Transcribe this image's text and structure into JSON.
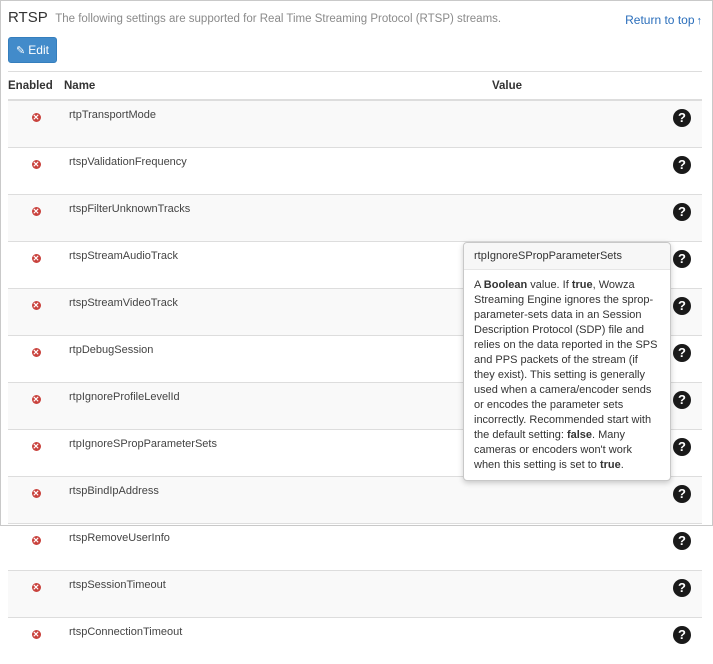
{
  "header": {
    "title": "RTSP",
    "subtitle": "The following settings are supported for Real Time Streaming Protocol (RTSP) streams.",
    "top_link": "Return to top",
    "top_link_icon": "arrow-up-icon"
  },
  "toolbar": {
    "edit_label": "Edit",
    "edit_icon": "pencil-icon",
    "edit_color": "#428bca"
  },
  "table": {
    "columns": [
      "Enabled",
      "Name",
      "Value"
    ],
    "rows": [
      {
        "enabled": false,
        "name": "rtpTransportMode",
        "value": ""
      },
      {
        "enabled": false,
        "name": "rtspValidationFrequency",
        "value": ""
      },
      {
        "enabled": false,
        "name": "rtspFilterUnknownTracks",
        "value": ""
      },
      {
        "enabled": false,
        "name": "rtspStreamAudioTrack",
        "value": ""
      },
      {
        "enabled": false,
        "name": "rtspStreamVideoTrack",
        "value": ""
      },
      {
        "enabled": false,
        "name": "rtpDebugSession",
        "value": ""
      },
      {
        "enabled": false,
        "name": "rtpIgnoreProfileLevelId",
        "value": ""
      },
      {
        "enabled": false,
        "name": "rtpIgnoreSPropParameterSets",
        "value": ""
      },
      {
        "enabled": false,
        "name": "rtspBindIpAddress",
        "value": ""
      },
      {
        "enabled": false,
        "name": "rtspRemoveUserInfo",
        "value": ""
      },
      {
        "enabled": false,
        "name": "rtspSessionTimeout",
        "value": ""
      },
      {
        "enabled": false,
        "name": "rtspConnectionTimeout",
        "value": ""
      }
    ],
    "disabled_icon": "x-circle-icon",
    "disabled_color": "#c9423d",
    "help_icon": "question-circle-icon"
  },
  "tooltip": {
    "title": "rtpIgnoreSPropParameterSets",
    "body_parts": [
      {
        "text": "A ",
        "bold": false
      },
      {
        "text": "Boolean",
        "bold": true
      },
      {
        "text": " value. If ",
        "bold": false
      },
      {
        "text": "true",
        "bold": true
      },
      {
        "text": ", Wowza Streaming Engine ignores the sprop-parameter-sets data in an Session Description Protocol (SDP) file and relies on the data reported in the SPS and PPS packets of the stream (if they exist). This setting is generally used when a camera/encoder sends or encodes the parameter sets incorrectly. Recommended start with the default setting: ",
        "bold": false
      },
      {
        "text": "false",
        "bold": true
      },
      {
        "text": ". Many cameras or encoders won't work when this setting is set to ",
        "bold": false
      },
      {
        "text": "true",
        "bold": true
      },
      {
        "text": ".",
        "bold": false
      }
    ]
  }
}
